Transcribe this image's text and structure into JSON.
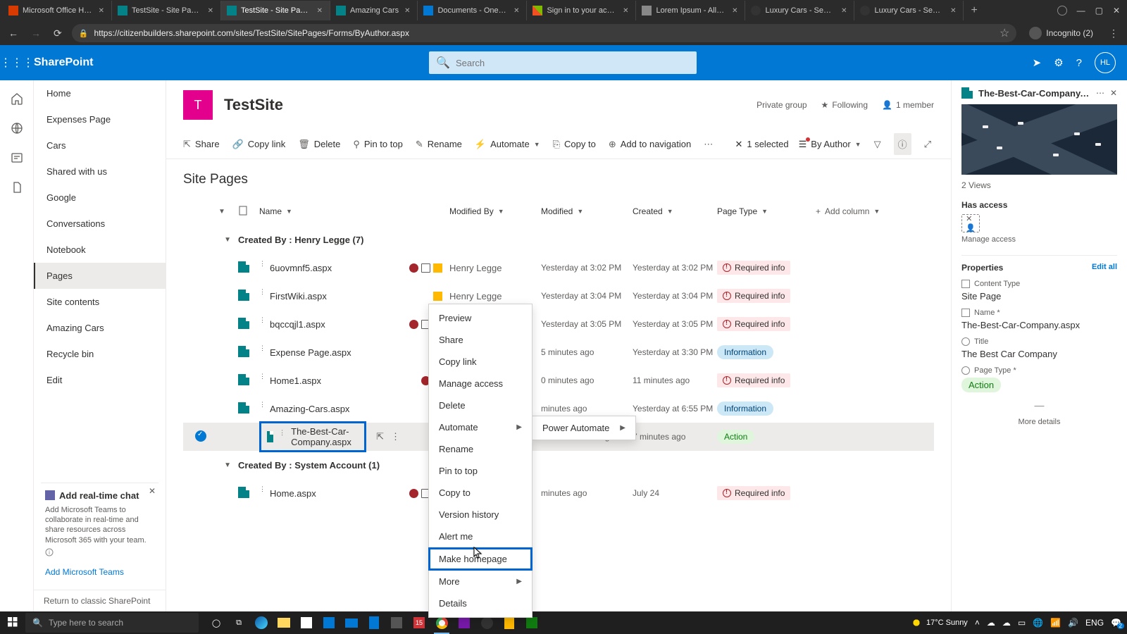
{
  "browser": {
    "tabs": [
      {
        "title": "Microsoft Office Home"
      },
      {
        "title": "TestSite - Site Pages -"
      },
      {
        "title": "TestSite - Site Pages -",
        "active": true
      },
      {
        "title": "Amazing Cars"
      },
      {
        "title": "Documents - OneDrive"
      },
      {
        "title": "Sign in to your account"
      },
      {
        "title": "Lorem Ipsum - All the"
      },
      {
        "title": "Luxury Cars - Sedans,"
      },
      {
        "title": "Luxury Cars - Sedans,"
      }
    ],
    "url": "https://citizenbuilders.sharepoint.com/sites/TestSite/SitePages/Forms/ByAuthor.aspx",
    "incognito": "Incognito (2)"
  },
  "suite": {
    "app": "SharePoint",
    "search_placeholder": "Search",
    "avatar_initials": "HL"
  },
  "site": {
    "logo_letter": "T",
    "title": "TestSite",
    "privacy": "Private group",
    "following": "Following",
    "members": "1 member"
  },
  "leftnav": {
    "items": [
      "Home",
      "Expenses Page",
      "Cars",
      "Shared with us",
      "Google",
      "Conversations",
      "Notebook",
      "Pages",
      "Site contents",
      "Amazing Cars",
      "Recycle bin",
      "Edit"
    ],
    "selected": "Pages",
    "promo_title": "Add real-time chat",
    "promo_text": "Add Microsoft Teams to collaborate in real-time and share resources across Microsoft 365 with your team.",
    "promo_link": "Add Microsoft Teams",
    "classic": "Return to classic SharePoint"
  },
  "cmdbar": {
    "items": [
      "Share",
      "Copy link",
      "Delete",
      "Pin to top",
      "Rename",
      "Automate",
      "Copy to",
      "Add to navigation"
    ],
    "selected": "1 selected",
    "view": "By Author"
  },
  "list": {
    "title": "Site Pages",
    "columns": [
      "Name",
      "Modified By",
      "Modified",
      "Created",
      "Page Type",
      "Add column"
    ],
    "group1": "Created By : Henry Legge (7)",
    "group2": "Created By : System Account (1)",
    "rows1": [
      {
        "name": "6uovmnf5.aspx",
        "ind": [
          "red",
          "share",
          "yel"
        ],
        "modby": "Henry Legge",
        "mod": "Yesterday at 3:02 PM",
        "created": "Yesterday at 3:02 PM",
        "ptype": "req"
      },
      {
        "name": "FirstWiki.aspx",
        "ind": [
          "yel"
        ],
        "modby": "Henry Legge",
        "mod": "Yesterday at 3:04 PM",
        "created": "Yesterday at 3:04 PM",
        "ptype": "req"
      },
      {
        "name": "bqccqjl1.aspx",
        "ind": [
          "red",
          "share",
          "yel"
        ],
        "modby": "",
        "mod": "Yesterday at 3:05 PM",
        "created": "Yesterday at 3:05 PM",
        "ptype": "req"
      },
      {
        "name": "Expense Page.aspx",
        "ind": [],
        "modby": "",
        "mod": "5 minutes ago",
        "created": "Yesterday at 3:30 PM",
        "ptype": "info"
      },
      {
        "name": "Home1.aspx",
        "ind": [
          "red",
          "yel"
        ],
        "modby": "",
        "mod": "0 minutes ago",
        "created": "11 minutes ago",
        "ptype": "req"
      },
      {
        "name": "Amazing-Cars.aspx",
        "ind": [
          "red"
        ],
        "modby": "",
        "mod": "minutes ago",
        "created": "Yesterday at 6:55 PM",
        "ptype": "info"
      },
      {
        "name": "The-Best-Car-Company.aspx",
        "ind": [],
        "modby": "",
        "mod": "About a minute ago",
        "created": "7 minutes ago",
        "ptype": "act",
        "sel": true
      }
    ],
    "rows2": [
      {
        "name": "Home.aspx",
        "ind": [
          "red",
          "share",
          "yel"
        ],
        "modby": "",
        "mod": "minutes ago",
        "created": "July 24",
        "ptype": "req"
      }
    ],
    "required": "Required info",
    "information": "Information",
    "action": "Action"
  },
  "ctx": {
    "items": [
      "Preview",
      "Share",
      "Copy link",
      "Manage access",
      "Delete",
      "Automate",
      "Rename",
      "Pin to top",
      "Copy to",
      "Version history",
      "Alert me",
      "Make homepage",
      "More",
      "Details"
    ],
    "highlighted": "Make homepage",
    "submenu": "Automate",
    "flyout": "Power Automate"
  },
  "details": {
    "filename": "The-Best-Car-Company.a...",
    "views": "2 Views",
    "has_access": "Has access",
    "manage_access": "Manage access",
    "properties": "Properties",
    "edit_all": "Edit all",
    "content_type_lbl": "Content Type",
    "content_type": "Site Page",
    "name_lbl": "Name *",
    "name_val": "The-Best-Car-Company.aspx",
    "title_lbl": "Title",
    "title_val": "The Best Car Company",
    "page_type_lbl": "Page Type *",
    "page_type_val": "Action",
    "more": "More details"
  },
  "taskbar": {
    "search_placeholder": "Type here to search",
    "weather": "17°C  Sunny",
    "lang": "ENG"
  }
}
